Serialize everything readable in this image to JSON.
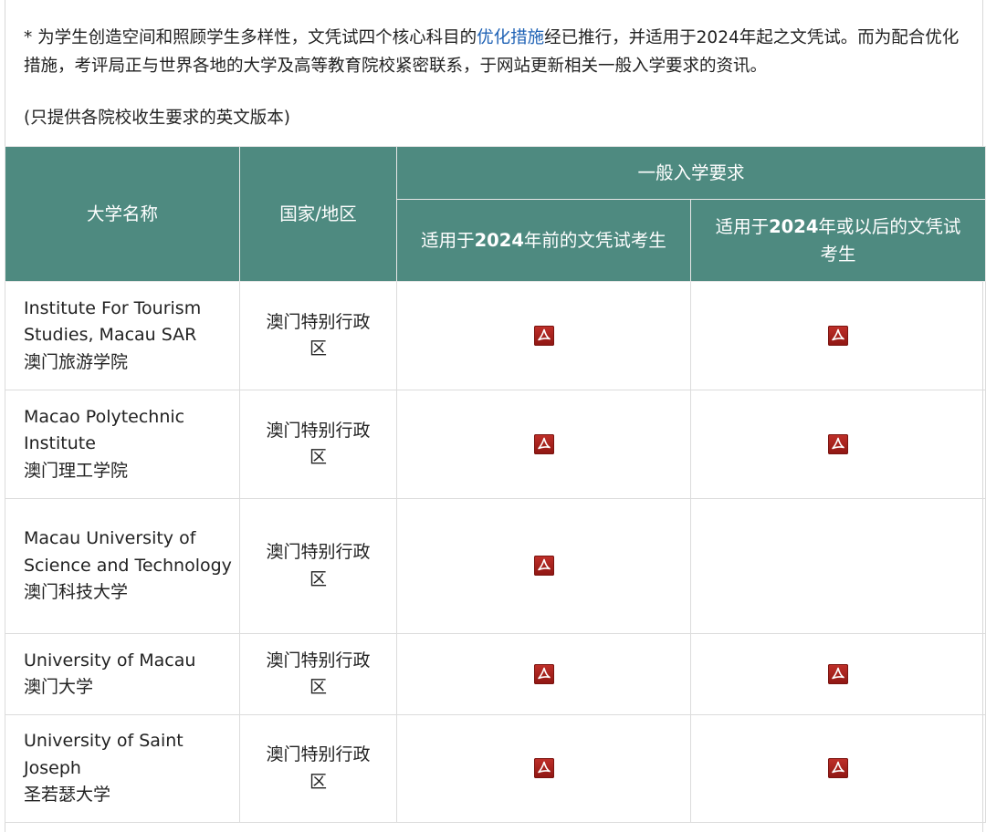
{
  "notice": {
    "prefix": "* 为学生创造空间和照顾学生多样性，文凭试四个核心科目的",
    "link": "优化措施",
    "suffix": "经已推行，并适用于2024年起之文凭试。而为配合优化措施，考评局正与世界各地的大学及高等教育院校紧密联系，于网站更新相关一般入学要求的资讯。"
  },
  "note2": "(只提供各院校收生要求的英文版本)",
  "table": {
    "headers": {
      "university": "大学名称",
      "country": "国家/地区",
      "general": "一般入学要求",
      "before_pre": "适用于",
      "before_year": "2024",
      "before_post": "年前的文凭试考生",
      "after_pre": "适用于",
      "after_year": "2024",
      "after_post": "年或以后的文凭试考生"
    },
    "rows": [
      {
        "name_en": "Institute For Tourism Studies, Macau SAR",
        "name_zh": "澳门旅游学院",
        "country": "澳门特别行政区",
        "pdf_before": true,
        "pdf_after": true
      },
      {
        "name_en": "Macao Polytechnic Institute",
        "name_zh": "澳门理工学院",
        "country": "澳门特别行政区",
        "pdf_before": true,
        "pdf_after": true
      },
      {
        "name_en": "Macau University of Science and Technology",
        "name_zh": "澳门科技大学",
        "country": "澳门特别行政区",
        "pdf_before": true,
        "pdf_after": false
      },
      {
        "name_en": "University of Macau",
        "name_zh": "澳门大学",
        "country": "澳门特别行政区",
        "pdf_before": true,
        "pdf_after": true
      },
      {
        "name_en": "University of Saint Joseph",
        "name_zh": "圣若瑟大学",
        "country": "澳门特别行政区",
        "pdf_before": true,
        "pdf_after": true
      }
    ]
  },
  "icons": {
    "pdf": "pdf-icon"
  },
  "colors": {
    "header_bg": "#4e8a80",
    "link": "#1f62b5",
    "pdf_red": "#b3231d"
  }
}
